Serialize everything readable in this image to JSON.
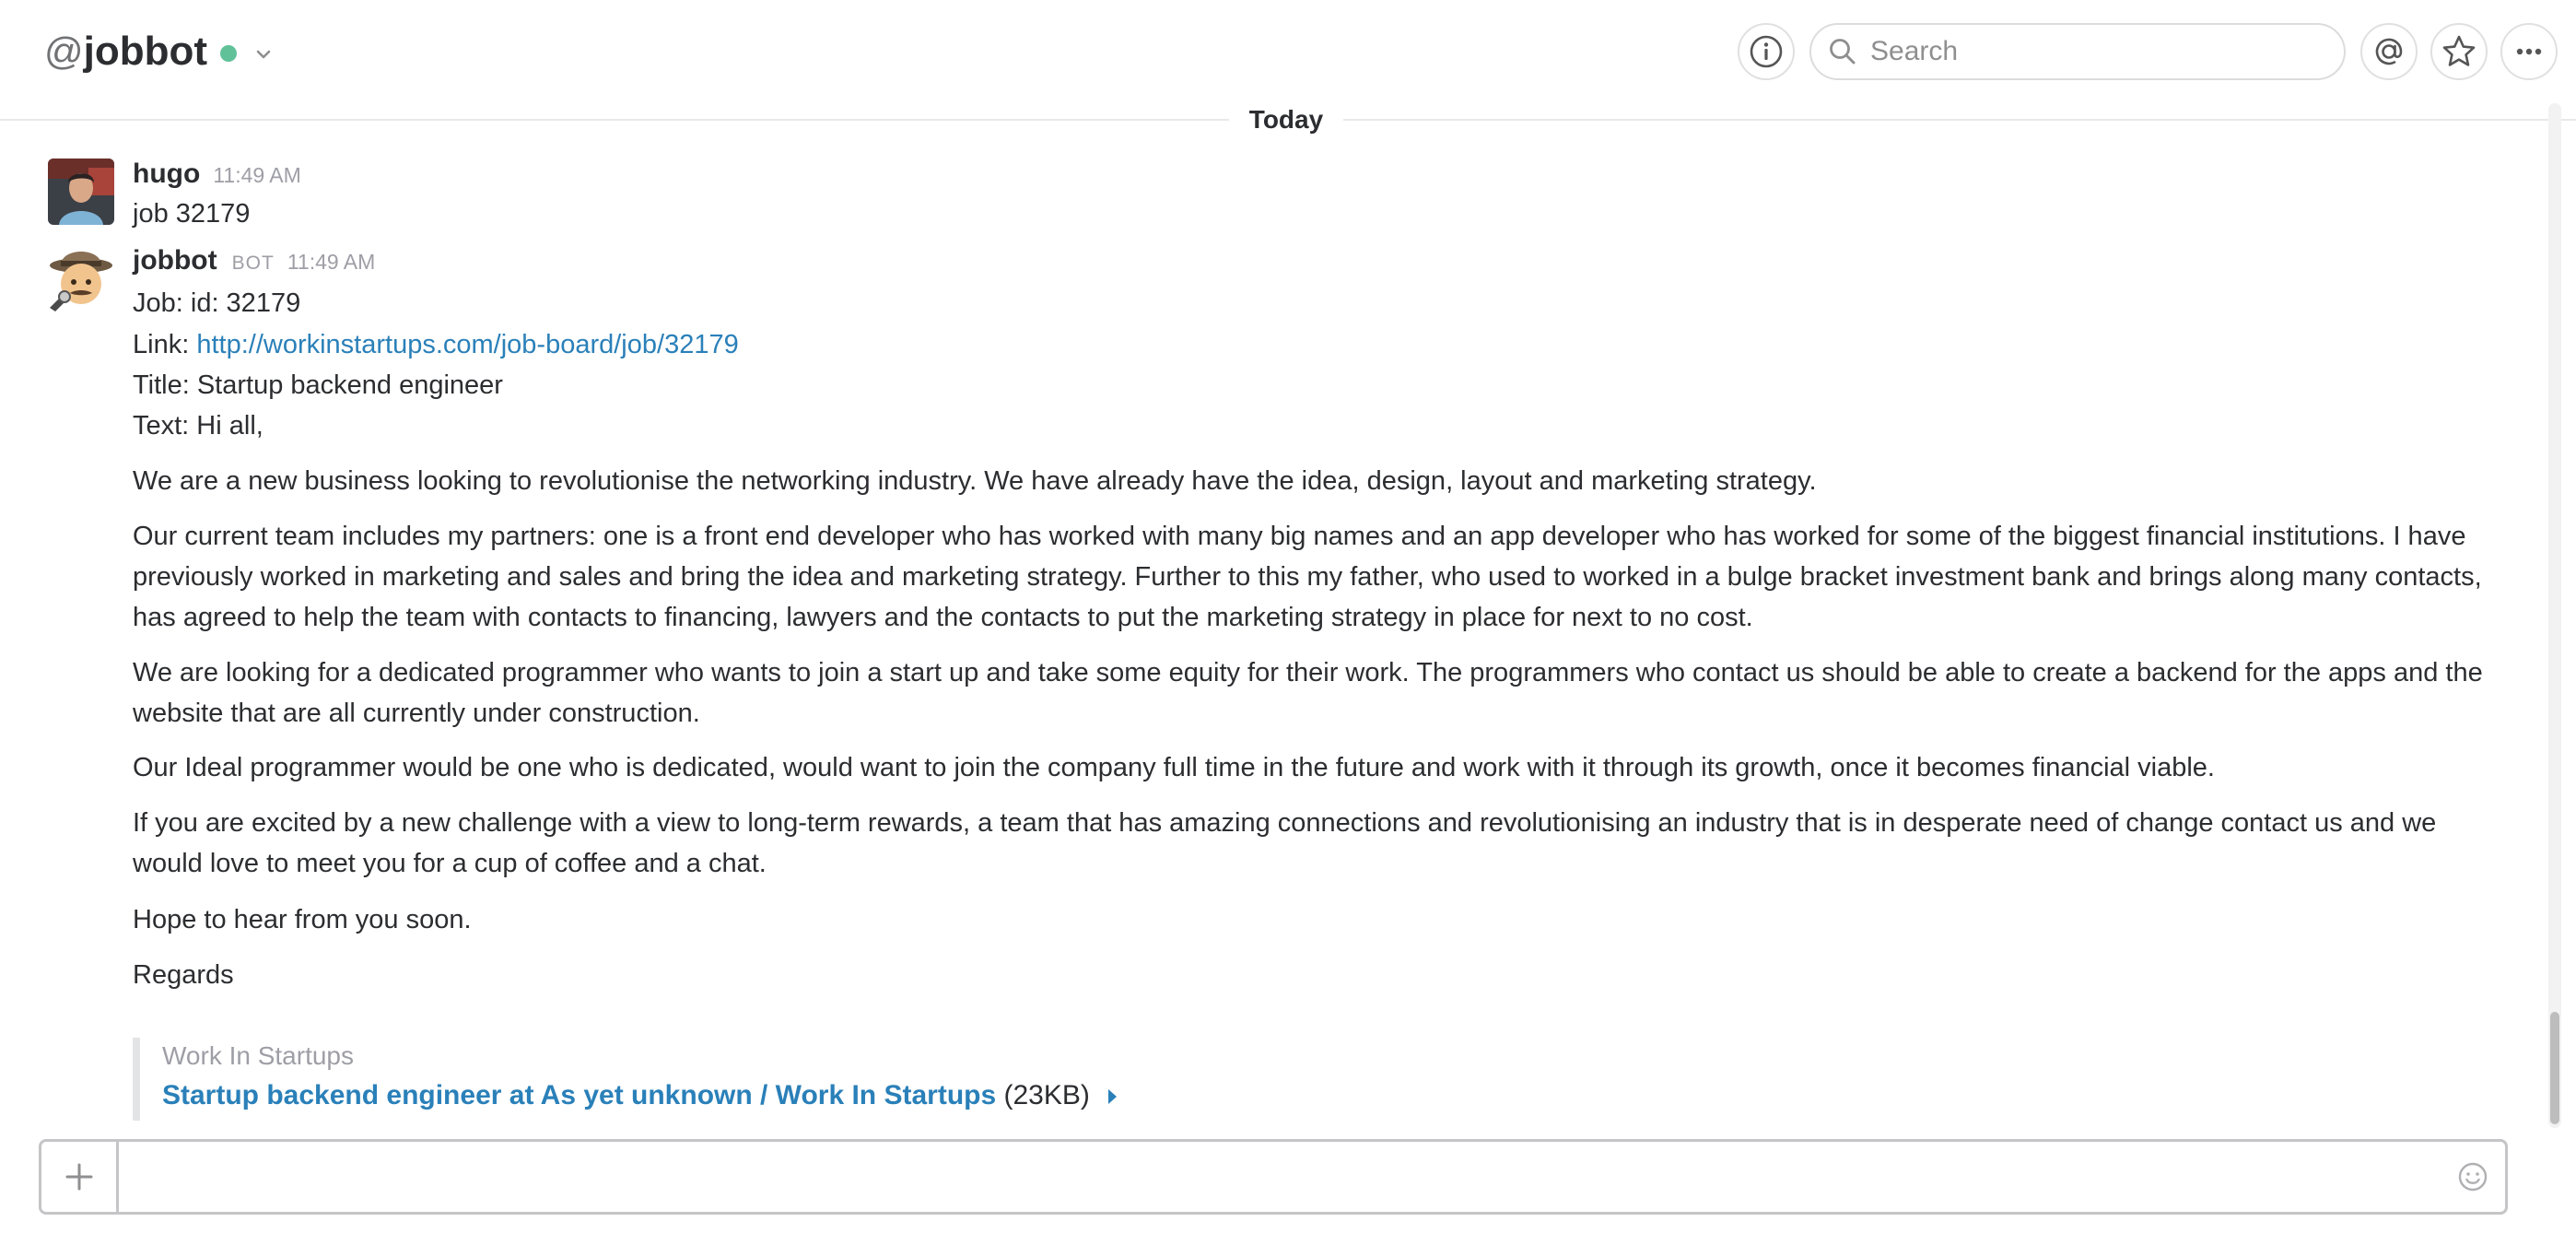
{
  "header": {
    "channel_prefix": "@",
    "channel_name": "jobbot",
    "presence": "active",
    "search_placeholder": "Search",
    "icons": [
      "info-icon",
      "search-icon",
      "mentions-icon",
      "star-icon",
      "more-icon",
      "chevron-down-icon"
    ]
  },
  "divider": {
    "label": "Today"
  },
  "messages": [
    {
      "author": "hugo",
      "time": "11:49 AM",
      "text": "job 32179"
    },
    {
      "author": "jobbot",
      "badge": "BOT",
      "time": "11:49 AM",
      "job_id_line": "Job: id: 32179",
      "link_label": "Link: ",
      "link_url": "http://workinstartups.com/job-board/job/32179",
      "title_line": "Title: Startup backend engineer",
      "text_line": "Text: Hi all,",
      "paragraphs": [
        "We are a new business looking to revolutionise the networking industry. We have already have the idea, design, layout and marketing strategy.",
        "Our current team includes my partners: one is a front end developer who has worked with many big names and an app developer who has worked for some of the biggest financial institutions. I have previously worked in marketing and sales and bring the idea and marketing strategy. Further to this my father, who used to worked in a bulge bracket investment bank and brings along many contacts, has agreed to help the team with contacts to financing, lawyers and the contacts to put the marketing strategy in place for next to no cost.",
        "We are looking for a dedicated programmer who wants to join a start up and take some equity for their work. The programmers who contact us should be able to create a backend for the apps and the website that are all currently under construction.",
        "Our Ideal programmer would be one who is dedicated, would want to join the company full time in the future and work with it through its growth, once it becomes financial viable.",
        "If you are excited by a new challenge with a view to long-term rewards, a team that has amazing connections and revolutionising an industry that is in desperate need of change contact us and we would love to meet you for a cup of coffee and a chat.",
        "Hope to hear from you soon.",
        "Regards"
      ],
      "attachment": {
        "service": "Work In Startups",
        "title": "Startup backend engineer  at As yet unknown / Work In Startups",
        "size": "(23KB)"
      }
    }
  ],
  "composer": {
    "placeholder": ""
  },
  "colors": {
    "link": "#2a80b9",
    "presence": "#2bac76",
    "muted": "#9e9ea6"
  }
}
